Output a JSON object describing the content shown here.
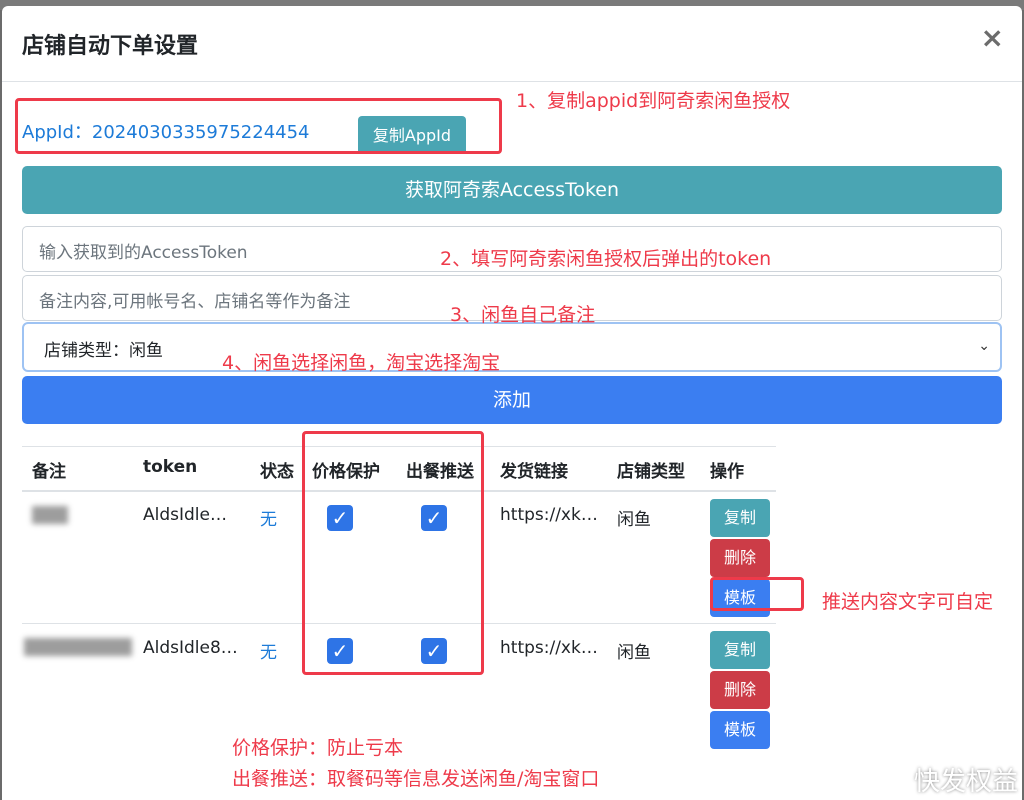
{
  "dialog": {
    "title": "店铺自动下单设置",
    "close_label": "×"
  },
  "appid": {
    "label": "AppId：",
    "value": "2024030335975224454",
    "copy_button": "复制AppId"
  },
  "token_button": "获取阿奇索AccessToken",
  "token_input": {
    "placeholder": "输入获取到的AccessToken"
  },
  "note_input": {
    "placeholder": "备注内容,可用帐号名、店铺名等作为备注"
  },
  "shop_type_select": {
    "value": "店铺类型：闲鱼",
    "caret": "⌄"
  },
  "add_button": "添加",
  "table": {
    "headers": [
      "备注",
      "token",
      "状态",
      "价格保护",
      "出餐推送",
      "发货链接",
      "店铺类型",
      "操作"
    ],
    "rows": [
      {
        "token": "AldsIdle…",
        "status": "无",
        "price_protect": true,
        "meal_push": true,
        "link": "https://xk…",
        "shop_type": "闲鱼"
      },
      {
        "token": "AldsIdle8…",
        "status": "无",
        "price_protect": true,
        "meal_push": true,
        "link": "https://xk…",
        "shop_type": "闲鱼"
      }
    ],
    "actions": {
      "copy": "复制",
      "delete": "删除",
      "template": "模板"
    }
  },
  "annotations": {
    "step1": "1、复制appid到阿奇索闲鱼授权",
    "step2": "2、填写阿奇索闲鱼授权后弹出的token",
    "step3": "3、闲鱼自己备注",
    "step4": "4、闲鱼选择闲鱼，淘宝选择淘宝",
    "template_note": "推送内容文字可自定",
    "price_note": "价格保护：防止亏本",
    "meal_note": "出餐推送：取餐码等信息发送闲鱼/淘宝窗口"
  },
  "watermark": "快发权益",
  "colors": {
    "info": "#4aa5b3",
    "primary": "#3b7ef1",
    "danger": "#cc3c47",
    "annotation": "#ee3a4a",
    "link": "#1d7bd8"
  }
}
